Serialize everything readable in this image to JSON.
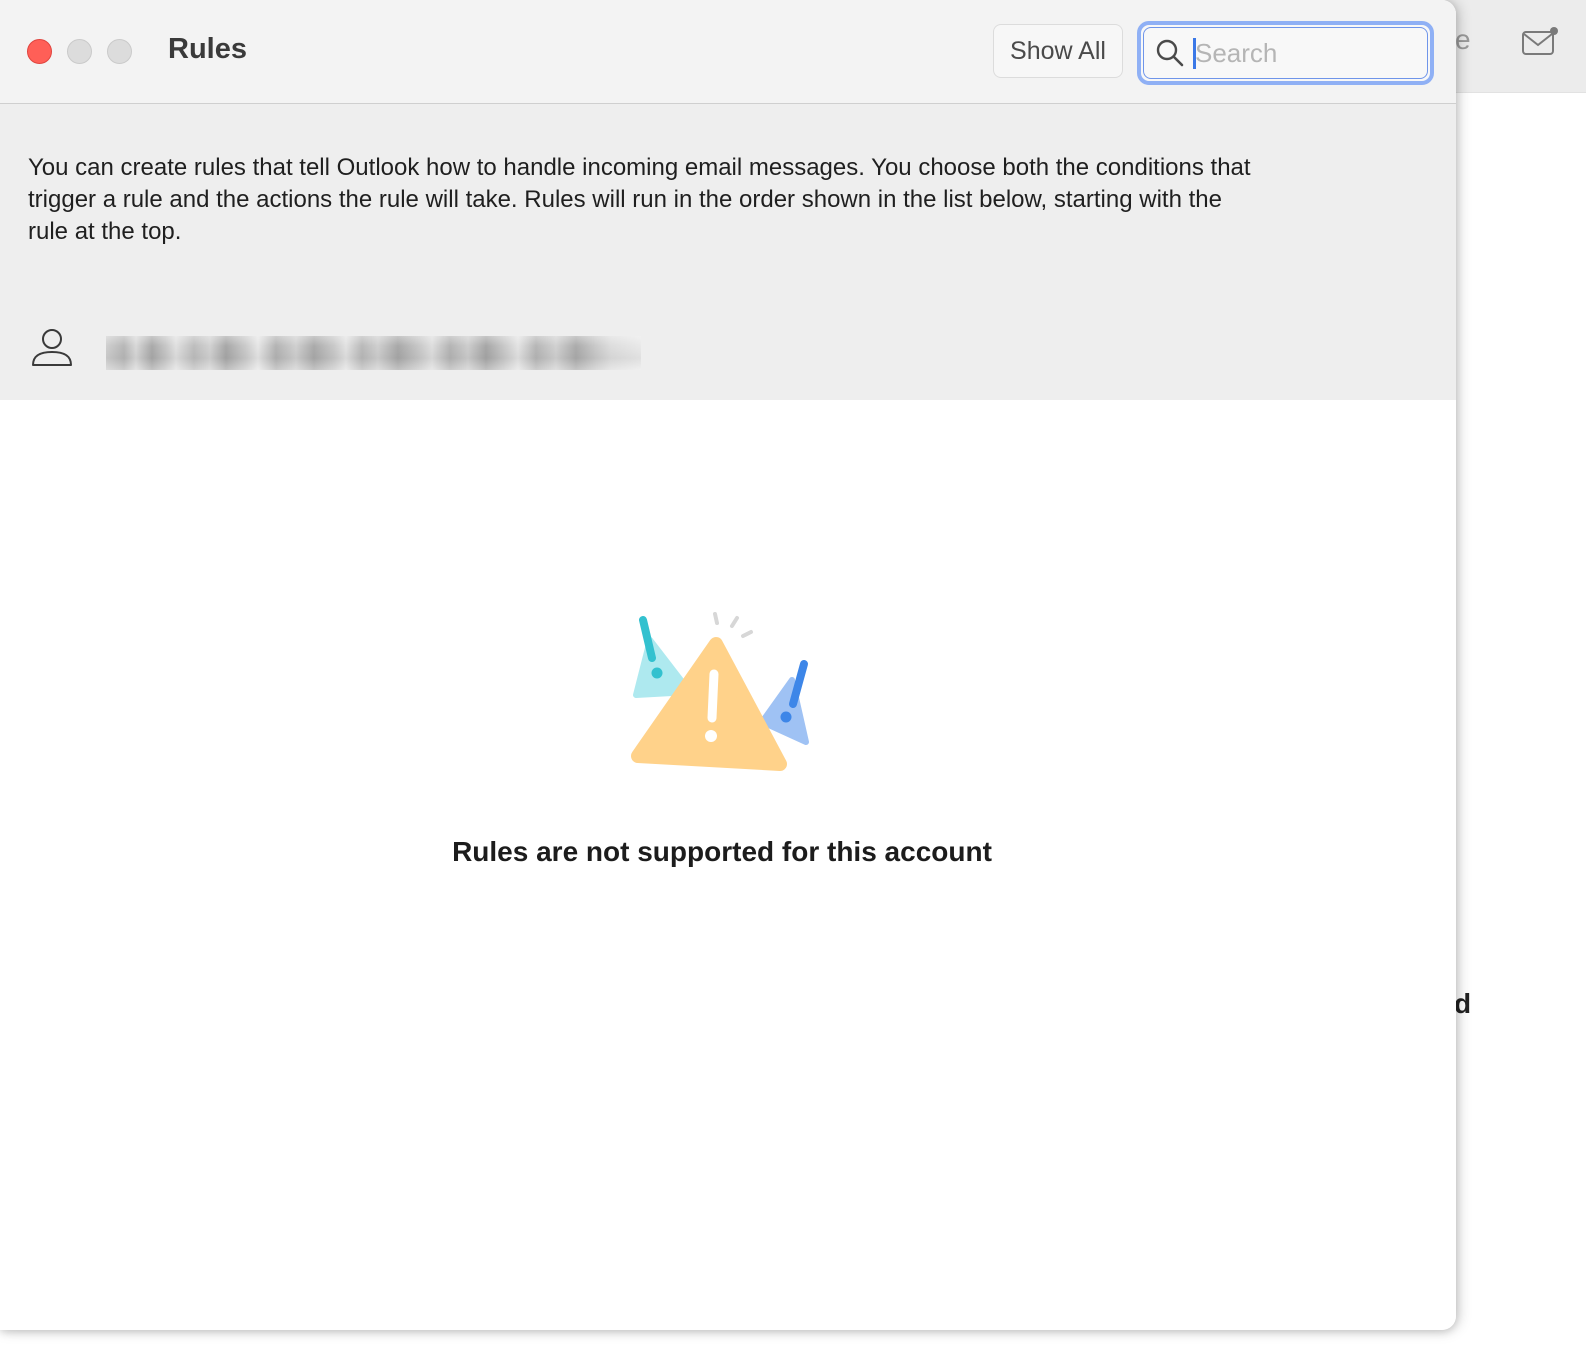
{
  "window": {
    "title": "Rules",
    "show_all_label": "Show All"
  },
  "search": {
    "placeholder": "Search",
    "value": ""
  },
  "header": {
    "description": "You can create rules that tell Outlook how to handle incoming email messages. You choose both the conditions that trigger a rule and the actions the rule will take. Rules will run in the order shown in the list below, starting with the rule at the top.",
    "account": {
      "icon": "person-icon",
      "name_redacted": true
    }
  },
  "empty_state": {
    "icon": "warning-illustration",
    "message": "Rules are not supported for this account"
  },
  "background_app": {
    "toolbar_fragment": "e",
    "text_fragment": "d",
    "icon": "mail-icon"
  },
  "colors": {
    "close": "#ff5f57",
    "focus_ring": "#8fb0f5",
    "warning_orange": "#ffd28a",
    "accent_teal": "#33c1cf",
    "accent_blue": "#3d86e8"
  }
}
